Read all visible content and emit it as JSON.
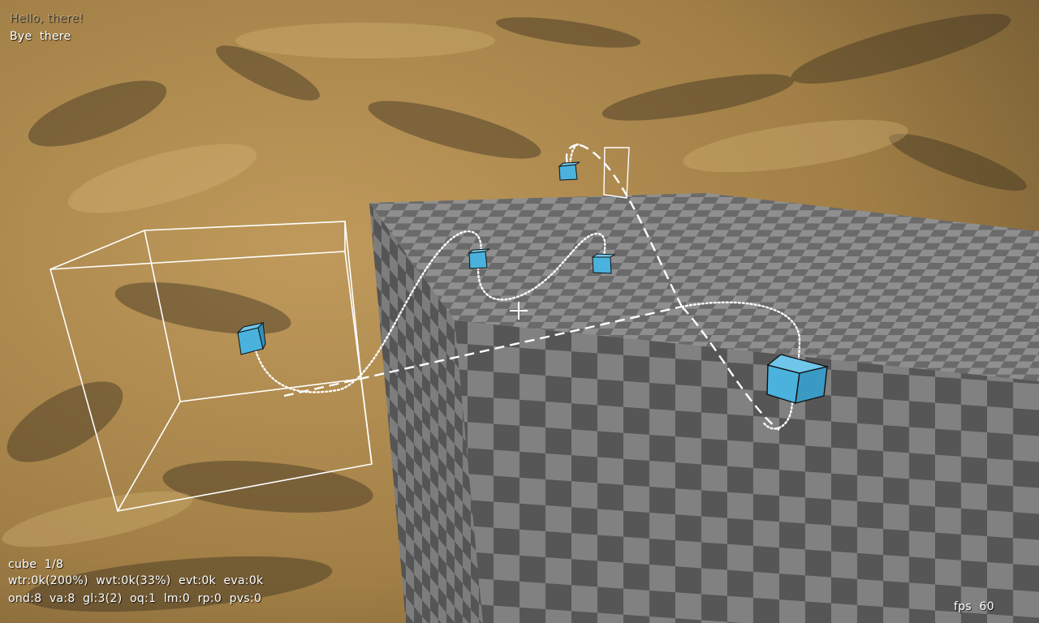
{
  "hud": {
    "greeting_faint": "Hello, there!",
    "greeting": "Bye  there",
    "stats_line1": "cube  1/8",
    "stats_line2": "wtr:0k(200%)  wvt:0k(33%)  evt:0k  eva:0k",
    "stats_line3": "ond:8  va:8  gl:3(2)  oq:1  lm:0  rp:0  pvs:0",
    "fps": "fps  60"
  },
  "colors": {
    "ground": "#9a7a44",
    "cube_face": "#4ab2dd",
    "checker_light": "#8a8a8a",
    "checker_dark": "#5e5e5e",
    "wireframe": "#ffffff"
  },
  "icons": {
    "crosshair": "crosshair-icon"
  }
}
